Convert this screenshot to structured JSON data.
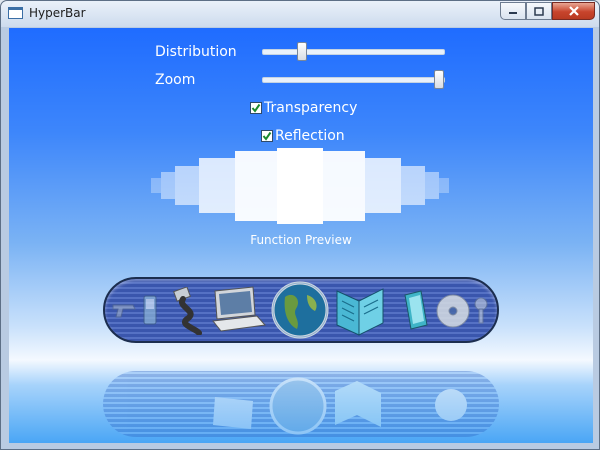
{
  "window": {
    "title": "HyperBar"
  },
  "caption_buttons": [
    "minimize",
    "maximize",
    "close"
  ],
  "controls": {
    "distribution": {
      "label": "Distribution",
      "value_fraction": 0.2
    },
    "zoom": {
      "label": "Zoom",
      "value_fraction": 1.0
    },
    "transparency": {
      "label": "Transparency",
      "checked": true
    },
    "reflection": {
      "label": "Reflection",
      "checked": true
    }
  },
  "preview": {
    "label": "Function Preview",
    "bar_opacity_levels": [
      0.3,
      0.45,
      0.6,
      0.8,
      0.95,
      1.0,
      0.95,
      0.8,
      0.6,
      0.45,
      0.3
    ]
  },
  "dock": {
    "items": [
      "gun-icon",
      "phone-icon",
      "usb-cable-icon",
      "laptop-icon",
      "globe-icon",
      "book-icon",
      "tablet-icon",
      "cd-icon",
      "key-icon"
    ]
  },
  "colors": {
    "client_top": "#1f6cff",
    "horizon": "#f4f9ff",
    "dock_dark": "#1c2e4f",
    "dock_stripe": "#5571c4"
  }
}
